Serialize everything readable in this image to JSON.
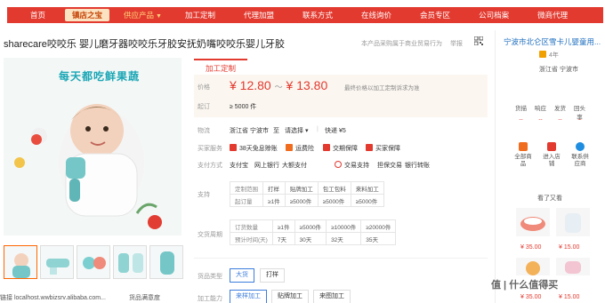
{
  "nav": {
    "home": "首页",
    "flagship": "镇店之宝",
    "supply": "供应产品",
    "items": [
      "加工定制",
      "代理加盟",
      "联系方式",
      "在线询价",
      "会员专区",
      "公司档案",
      "微商代理"
    ]
  },
  "product": {
    "title": "sharecare咬咬乐 婴儿磨牙器咬咬乐牙胶安抚奶嘴咬咬乐婴儿牙胶",
    "note": "本产品采购属于商业贸易行为",
    "report": "举报",
    "image_caption": "每天都吃鲜果蔬",
    "link": "链接 localhost.wwbizsrv.alibaba.com...",
    "rating": "货品满意度"
  },
  "detail": {
    "tab": "加工定制",
    "price_label": "价格",
    "price_low": "¥ 12.80",
    "price_sep": "～",
    "price_high": "¥ 13.80",
    "price_note": "最终价格以加工定制诉求为准",
    "moq_label": "起订",
    "moq_value": "≥ 5000 件",
    "logistics_label": "物流",
    "logistics_from": "浙江省 宁波市",
    "logistics_to": "至",
    "logistics_select": "请选择",
    "logistics_express": "快递 ¥5",
    "services_label": "买家服务",
    "services": [
      "38天免息赊账",
      "运费险",
      "交期保障",
      "买家保障"
    ],
    "payment_label": "支付方式",
    "payments": [
      "支付宝",
      "网上银行",
      "大额支付"
    ],
    "payments2": [
      "交易支持",
      "担保交易",
      "银行转账"
    ],
    "support_label": "支持",
    "support_table": {
      "rows": [
        [
          "定制范围",
          "打样",
          "贴牌加工",
          "包工包料",
          "来料加工"
        ],
        [
          "起订量",
          "≥1件",
          "≥5000件",
          "≥5000件",
          "≥5000件"
        ]
      ]
    },
    "lead_label": "交货周期",
    "lead_table": {
      "rows": [
        [
          "订货数量",
          "≥1件",
          "≥5000件",
          "≥10000件",
          "≥20000件"
        ],
        [
          "预计时间(天)",
          "7天",
          "30天",
          "32天",
          "35天"
        ]
      ]
    },
    "type_label": "货品类型",
    "types": [
      "大货",
      "打样"
    ],
    "ability_label": "加工能力",
    "abilities": [
      "来样加工",
      "贴牌加工",
      "来图加工"
    ]
  },
  "shop": {
    "name": "宁波市北仑区雪卡儿婴童用...",
    "years": "4年",
    "location": "浙江省 宁波市",
    "metrics_labels": [
      "货描",
      "响应",
      "发货",
      "回头率"
    ],
    "metrics_values": [
      "--",
      "--",
      "--",
      "--"
    ],
    "links": [
      "全部商品",
      "进入店铺",
      "联系供应商"
    ],
    "seen_title": "看了又看",
    "seen_prices": [
      "¥ 35.00",
      "¥ 15.00",
      "¥ 35.00",
      "¥ 15.00"
    ]
  },
  "watermark": "值 | 什么值得买",
  "colors": {
    "nav_red": "#e33a2f",
    "price_red": "#e33a2f",
    "link_blue": "#1f6fbf",
    "select_blue": "#3b7ddd"
  }
}
